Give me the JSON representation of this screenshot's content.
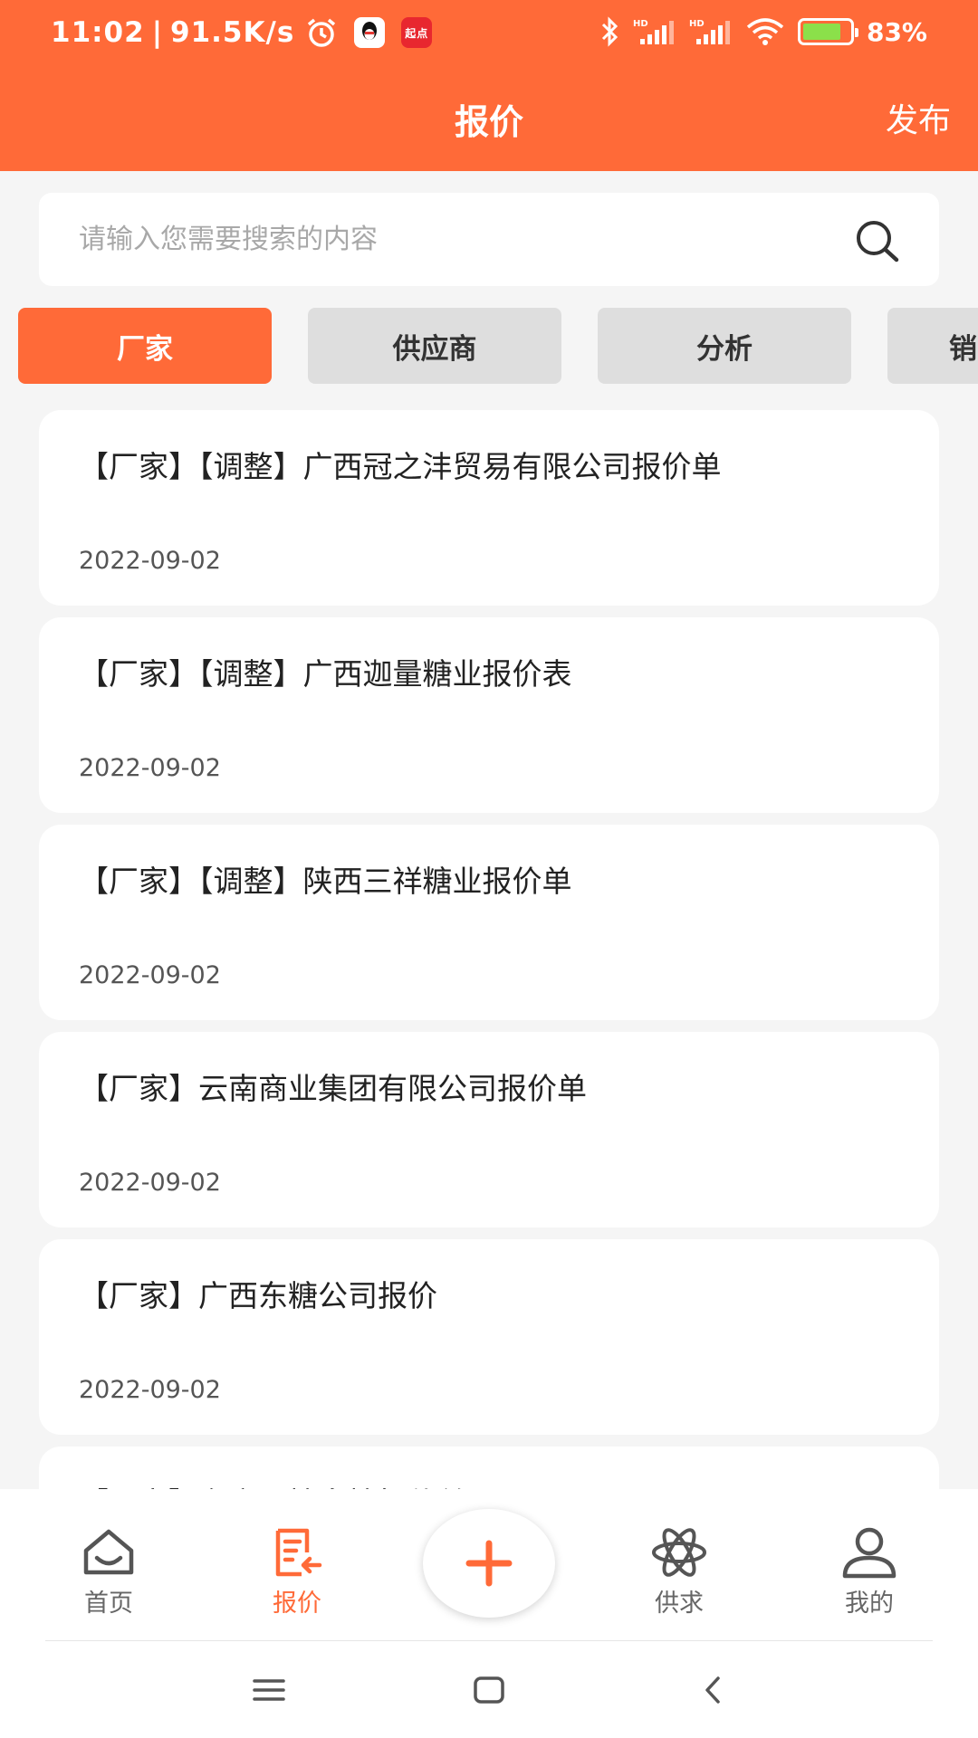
{
  "status_bar": {
    "time": "11:02",
    "speed": "91.5K/s",
    "qidian_label": "起点",
    "battery": "83%",
    "icons": [
      "alarm-icon",
      "qq-icon",
      "qidian-icon",
      "bluetooth-icon",
      "signal-hd-icon",
      "signal-hd-icon",
      "wifi-icon",
      "battery-icon"
    ]
  },
  "header": {
    "title": "报价",
    "publish": "发布"
  },
  "search": {
    "placeholder": "请输入您需要搜索的内容"
  },
  "tabs": [
    {
      "label": "厂家",
      "active": true
    },
    {
      "label": "供应商",
      "active": false
    },
    {
      "label": "分析",
      "active": false
    },
    {
      "label": "销",
      "active": false
    }
  ],
  "list": [
    {
      "title": "【厂家】【调整】广西冠之沣贸易有限公司报价单",
      "date": "2022-09-02"
    },
    {
      "title": "【厂家】【调整】广西迦量糖业报价表",
      "date": "2022-09-02"
    },
    {
      "title": "【厂家】【调整】陕西三祥糖业报价单",
      "date": "2022-09-02"
    },
    {
      "title": "【厂家】云南商业集团有限公司报价单",
      "date": "2022-09-02"
    },
    {
      "title": "【厂家】广西东糖公司报价",
      "date": "2022-09-02"
    },
    {
      "title": "【厂家】东方冈糖白糖报价单",
      "date": ""
    }
  ],
  "tabbar": {
    "home": "首页",
    "quote": "报价",
    "supply": "供求",
    "mine": "我的"
  },
  "colors": {
    "accent": "#ff6a38",
    "tab_inactive": "#dedede",
    "background": "#f5f5f5"
  }
}
